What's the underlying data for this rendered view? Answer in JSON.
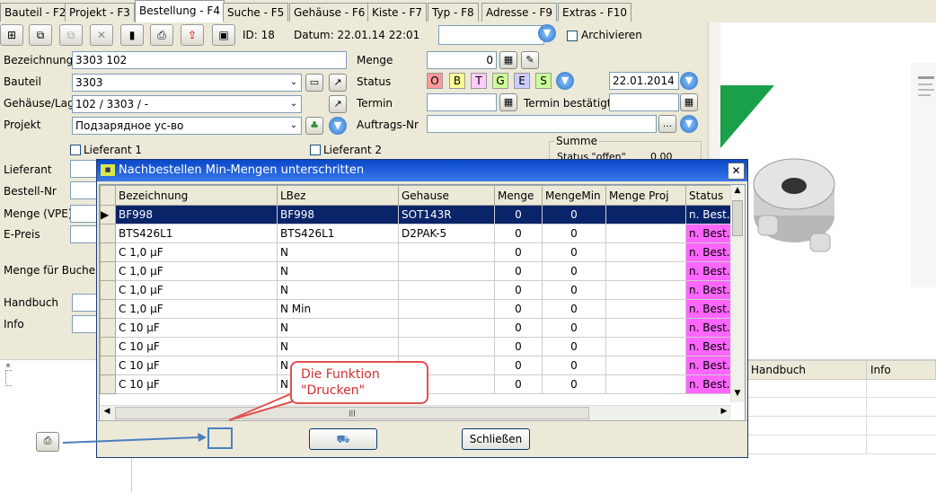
{
  "tabs": [
    "Bauteil - F2",
    "Projekt - F3",
    "Bestellung - F4",
    "Suche - F5",
    "Gehäuse - F6",
    "Kiste - F7",
    "Typ - F8",
    "Adresse - F9",
    "Extras - F10"
  ],
  "toolbar": {
    "id_label": "ID: 18",
    "datum_label": "Datum: 22.01.14 22:01",
    "archivieren": "Archivieren"
  },
  "form": {
    "bezeichnung_label": "Bezeichnung",
    "bezeichnung_value": "3303 102",
    "bauteil_label": "Bauteil",
    "bauteil_value": "3303",
    "gehaeuse_label": "Gehäuse/Lag",
    "gehaeuse_value": "102 / 3303 / -",
    "projekt_label": "Projekt",
    "projekt_value": "Подзарядное ус-во",
    "menge_label": "Menge",
    "menge_value": "0",
    "status_label": "Status",
    "status_letters": [
      "O",
      "B",
      "T",
      "G",
      "E",
      "S"
    ],
    "status_date": "22.01.2014",
    "termin_label": "Termin",
    "termin_bestaetigt_label": "Termin bestätigt",
    "auftrags_label": "Auftrags-Nr",
    "auftrags_btn": "...",
    "lieferant1": "Lieferant 1",
    "lieferant2": "Lieferant 2",
    "summe_label": "Summe",
    "status_offen": "Status \"offen\"",
    "summe_value": "0.00",
    "lieferant_label": "Lieferant",
    "bestell_nr_label": "Bestell-Nr",
    "menge_vpe_label": "Menge (VPE)",
    "e_preis_label": "E-Preis",
    "menge_buchen_label": "Menge für Buchen",
    "handbuch_label": "Handbuch",
    "info_label": "Info"
  },
  "lower": {
    "row_marker": "*",
    "handbuch_header": "Handbuch",
    "info_header": "Info"
  },
  "dialog": {
    "title": "Nachbestellen Min-Mengen unterschritten",
    "close": "✕",
    "columns": [
      "Bezeichnung",
      "LBez",
      "Gehause",
      "Menge",
      "MengeMin",
      "Menge Proj",
      "Status"
    ],
    "rows": [
      [
        "BF998",
        "BF998",
        "SOT143R",
        "0",
        "0",
        "",
        "n. Best."
      ],
      [
        "BTS426L1",
        "BTS426L1",
        "D2PAK-5",
        "0",
        "0",
        "",
        "n. Best."
      ],
      [
        "C 1,0 µF",
        "N",
        "",
        "0",
        "0",
        "",
        "n. Best."
      ],
      [
        "C 1,0 µF",
        "N",
        "",
        "0",
        "0",
        "",
        "n. Best."
      ],
      [
        "C 1,0 µF",
        "N",
        "",
        "0",
        "0",
        "",
        "n. Best."
      ],
      [
        "C 1,0 µF",
        "N Min",
        "",
        "0",
        "0",
        "",
        "n. Best."
      ],
      [
        "C 10 µF",
        "N",
        "",
        "0",
        "0",
        "",
        "n. Best."
      ],
      [
        "C 10 µF",
        "N",
        "",
        "0",
        "0",
        "",
        "n. Best."
      ],
      [
        "C 10 µF",
        "N",
        "",
        "0",
        "0",
        "",
        "n. Best."
      ],
      [
        "C 10 µF",
        "N",
        "",
        "0",
        "0",
        "",
        "n. Best."
      ]
    ],
    "close_button": "Schließen",
    "scroll_grip": "|||"
  },
  "annotation": {
    "callout_line1": "Die Funktion",
    "callout_line2": "\"Drucken\""
  },
  "colors": {
    "status_pink": "#ff66ff",
    "selection": "#0a246a",
    "titlebar": "#0a49c6",
    "callout": "#e05050",
    "arrow": "#4a7fc0"
  }
}
